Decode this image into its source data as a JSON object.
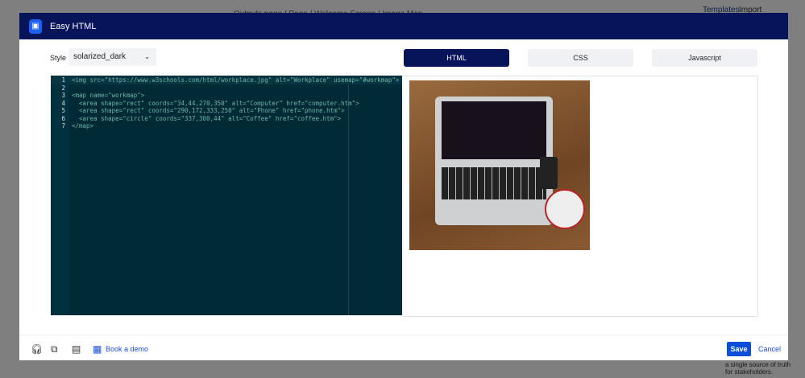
{
  "background": {
    "breadcrumb": "Outputs.page / Page / Welcome Screen / Image Map",
    "tabs": [
      "Templates",
      "Import"
    ],
    "side_text": "a single source of truth for stakeholders."
  },
  "modal": {
    "title": "Easy HTML",
    "style_label": "Style",
    "style_value": "solarized_dark",
    "tabs": [
      {
        "label": "HTML",
        "active": true
      },
      {
        "label": "CSS",
        "active": false
      },
      {
        "label": "Javascript",
        "active": false
      }
    ],
    "code_lines": [
      "<img src=\"https://www.w3schools.com/html/workplace.jpg\" alt=\"Workplace\" usemap=\"#workmap\">",
      "",
      "<map name=\"workmap\">",
      "  <area shape=\"rect\" coords=\"34,44,270,350\" alt=\"Computer\" href=\"computer.htm\">",
      "  <area shape=\"rect\" coords=\"290,172,333,250\" alt=\"Phone\" href=\"phone.htm\">",
      "  <area shape=\"circle\" coords=\"337,300,44\" alt=\"Coffee\" href=\"coffee.htm\">",
      "</map>"
    ],
    "preview_alt": "Workplace",
    "footer": {
      "demo": "Book a demo",
      "save": "Save",
      "cancel": "Cancel"
    }
  }
}
